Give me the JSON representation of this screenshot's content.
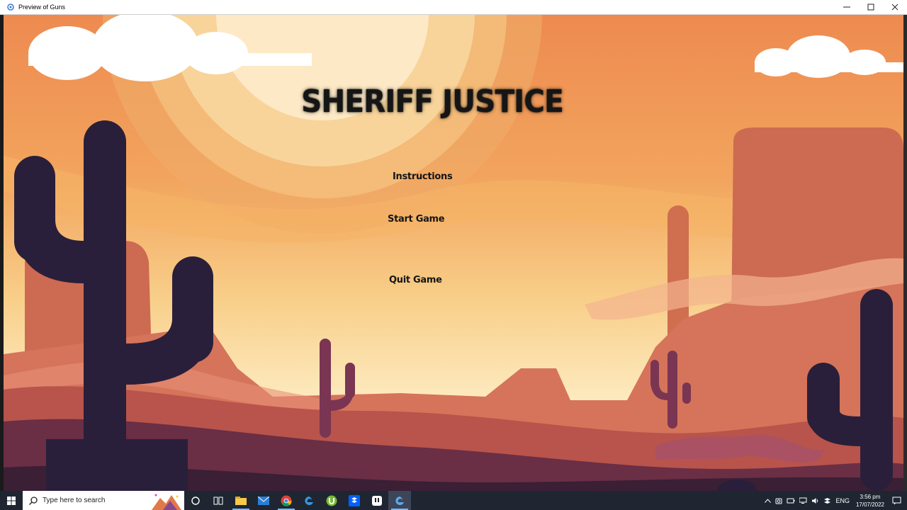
{
  "window": {
    "title": "Preview of Guns"
  },
  "game": {
    "title": "SHERIFF JUSTICE",
    "menu": {
      "instructions": "Instructions",
      "start": "Start Game",
      "quit": "Quit Game"
    }
  },
  "taskbar": {
    "search_placeholder": "Type here to search",
    "apps": [
      "cortana-icon",
      "task-view-icon",
      "file-explorer-icon",
      "mail-icon",
      "chrome-icon",
      "edge-icon",
      "utorrent-icon",
      "dropbox-icon",
      "app-icon",
      "game-preview-icon"
    ],
    "tray": {
      "language": "ENG",
      "time": "3:56 pm",
      "date": "17/07/2022"
    }
  },
  "colors": {
    "sky_top": "#ee8a50",
    "sky_mid": "#f5b466",
    "sky_low": "#fce6b2",
    "sun": "#fde9c3",
    "cactus": "#2a1f3a",
    "mesa": "#c8684f",
    "ground_dark": "#5a2a40"
  }
}
